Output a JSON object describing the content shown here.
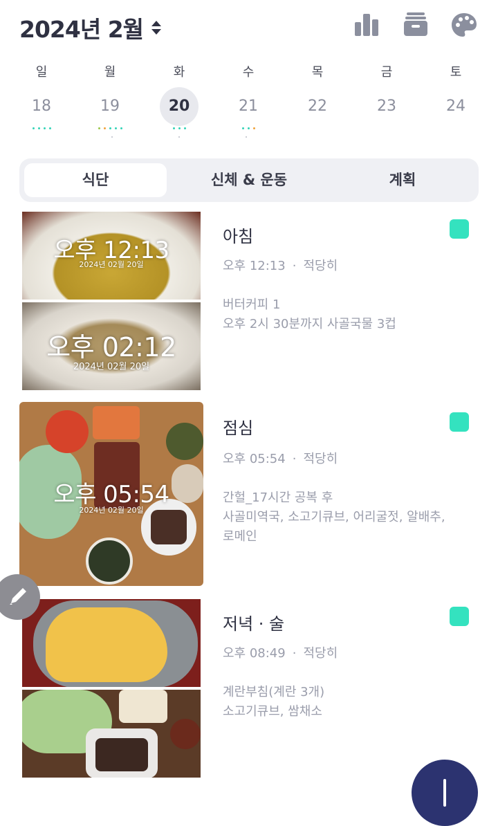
{
  "header": {
    "month_title": "2024년 2월",
    "icons": [
      "bar-chart-icon",
      "archive-box-icon",
      "palette-icon"
    ]
  },
  "week": {
    "days": [
      {
        "weekday": "일",
        "date": "18",
        "selected": false
      },
      {
        "weekday": "월",
        "date": "19",
        "selected": false
      },
      {
        "weekday": "화",
        "date": "20",
        "selected": true
      },
      {
        "weekday": "수",
        "date": "21",
        "selected": false
      },
      {
        "weekday": "목",
        "date": "22",
        "selected": false
      },
      {
        "weekday": "금",
        "date": "23",
        "selected": false
      },
      {
        "weekday": "토",
        "date": "24",
        "selected": false
      }
    ]
  },
  "tabs": [
    {
      "label": "식단",
      "active": true
    },
    {
      "label": "신체 & 운동",
      "active": false
    },
    {
      "label": "계획",
      "active": false
    }
  ],
  "meals": [
    {
      "title": "아침",
      "time": "오후 12:13",
      "amount": "적당히",
      "desc_lines": [
        "버터커피 1",
        "오후 2시 30분까지 사골국물 3컵"
      ],
      "photos": [
        {
          "stamp_time": "오후 12:13",
          "stamp_date": "2024년 02월 20일"
        },
        {
          "stamp_time": "오후 02:12",
          "stamp_date": "2024년 02월 20일"
        }
      ]
    },
    {
      "title": "점심",
      "time": "오후 05:54",
      "amount": "적당히",
      "desc_lines": [
        "간헐_17시간 공복 후",
        "사골미역국, 소고기큐브, 어리굴젓, 알배추,",
        "로메인"
      ],
      "photos": [
        {
          "stamp_time": "오후 05:54",
          "stamp_date": "2024년 02월 20일"
        }
      ]
    },
    {
      "title": "저녁 · 술",
      "time": "오후 08:49",
      "amount": "적당히",
      "desc_lines": [
        "계란부침(계란 3개)",
        "소고기큐브, 쌈채소"
      ],
      "photos": [
        {},
        {}
      ]
    }
  ],
  "colors": {
    "accent_badge": "#34e2bf",
    "fab": "#2c3370",
    "text_dark": "#2f3142",
    "text_muted": "#9a9dab"
  }
}
